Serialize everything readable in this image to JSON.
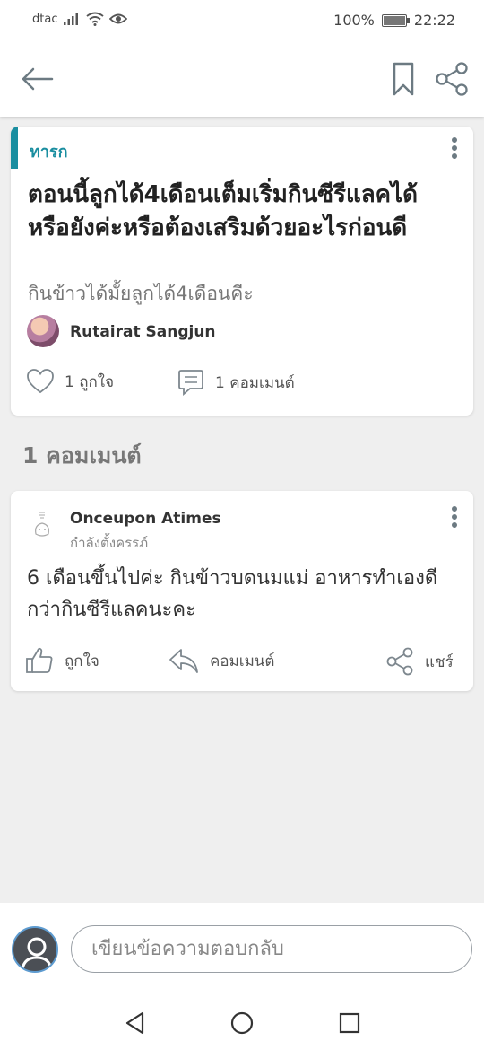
{
  "status_bar": {
    "carrier": "dtac",
    "battery": "100%",
    "time": "22:22",
    "icons": [
      "signal-icon",
      "wifi-icon",
      "eye-icon",
      "battery-icon"
    ]
  },
  "app_bar": {
    "icons": [
      "back-arrow-icon",
      "bookmark-icon",
      "share-icon"
    ]
  },
  "post": {
    "category": "ทารก",
    "title": "ตอนนี้ลูกได้4เดือนเต็มเริ่มกินซีรีแลคได้หรือยังค่ะหรือต้องเสริมด้วยอะไรก่อนดี",
    "subtitle": "กินข้าวได้มั้ยลูกได้4เดือนคีะ",
    "author": "Rutairat Sangjun",
    "likes_label": "1 ถูกใจ",
    "comments_label": "1 คอมเมนต์",
    "accent_color": "#1a8ea0"
  },
  "comments_heading": "1 คอมเมนต์",
  "comment": {
    "author": "Onceupon Atimes",
    "status": "กำลังตั้งครรภ์",
    "text": "6 เดือนขึ้นไปค่ะ  กินข้าวบดนมแม่ อาหารทำเองดีกว่ากินซีรีแลคนะคะ",
    "like_label": "ถูกใจ",
    "comment_label": "คอมเมนต์",
    "share_label": "แชร์"
  },
  "reply": {
    "placeholder": "เขียนข้อความตอบกลับ"
  },
  "nav": {
    "icons": [
      "back-triangle-icon",
      "home-circle-icon",
      "recents-square-icon"
    ]
  }
}
